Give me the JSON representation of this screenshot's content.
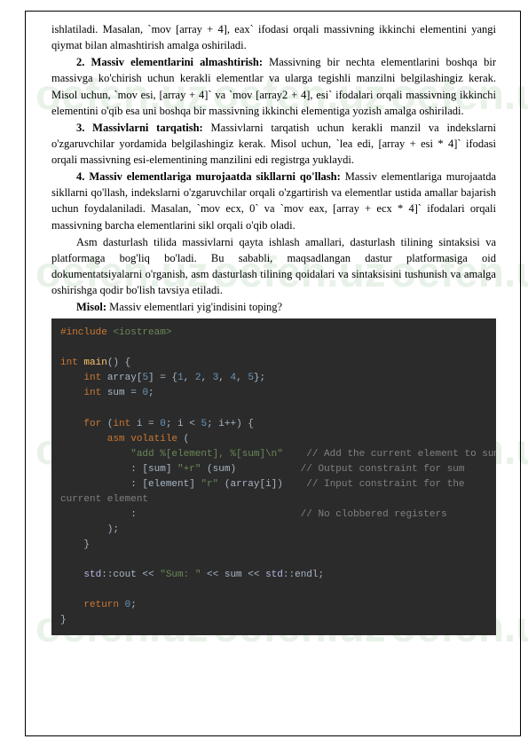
{
  "watermark": "oefen.uz",
  "paragraphs": {
    "p1": "ishlatiladi. Masalan, `mov [array + 4], eax` ifodasi orqali massivning ikkinchi elementini yangi qiymat bilan almashtirish amalga oshiriladi.",
    "p2_title": "2. Massiv elementlarini almashtirish:",
    "p2_body": " Massivning bir nechta elementlarini boshqa bir massivga ko'chirish uchun kerakli elementlar va ularga tegishli manzilni belgilashingiz kerak. Misol uchun, `mov esi, [array + 4]` va `mov [array2 + 4], esi` ifodalari orqali massivning ikkinchi elementini o'qib esa uni boshqa bir massivning ikkinchi elementiga yozish amalga oshiriladi.",
    "p3_title": "3. Massivlarni tarqatish:",
    "p3_body": " Massivlarni tarqatish uchun kerakli manzil va indekslarni o'zgaruvchilar yordamida belgilashingiz kerak. Misol uchun, `lea edi, [array + esi * 4]` ifodasi orqali massivning esi-elementining manzilini edi registrga yuklaydi.",
    "p4_title": "4. Massiv elementlariga murojaatda sikllarni qo'llash:",
    "p4_body": " Massiv elementlariga murojaatda sikllarni qo'llash, indekslarni o'zgaruvchilar orqali o'zgartirish va elementlar ustida amallar bajarish uchun foydalaniladi. Masalan, `mov ecx, 0` va `mov eax, [array + ecx * 4]` ifodalari orqali massivning barcha elementlarini sikl orqali o'qib oladi.",
    "p5": "Asm dasturlash tilida massivlarni qayta ishlash amallari, dasturlash tilining sintaksisi va platformaga bog'liq bo'ladi. Bu sababli, maqsadlangan dastur platformasiga oid dokumentatsiyalarni o'rganish, asm dasturlash tilining qoidalari va sintaksisini tushunish va amalga oshirishga qodir bo'lish tavsiya etiladi.",
    "p6_title": "Misol:",
    "p6_body": " Massiv elementlari yig'indisini toping?"
  },
  "code": {
    "l1_a": "#include",
    "l1_b": " <iostream>",
    "l3_a": "int",
    "l3_b": " main",
    "l3_c": "() {",
    "l4_a": "    int",
    "l4_b": " array",
    "l4_c": "[",
    "l4_d": "5",
    "l4_e": "] = {",
    "l4_f": "1",
    "l4_g": ", ",
    "l4_h": "2",
    "l4_i": "3",
    "l4_j": "4",
    "l4_k": "5",
    "l4_l": "};",
    "l5_a": "    int",
    "l5_b": " sum = ",
    "l5_c": "0",
    "l5_d": ";",
    "l7_a": "    for",
    "l7_b": " (",
    "l7_c": "int",
    "l7_d": " i = ",
    "l7_e": "0",
    "l7_f": "; i < ",
    "l7_g": "5",
    "l7_h": "; i++) {",
    "l8_a": "        asm volatile",
    "l8_b": " (",
    "l9_a": "            \"add %[element], %[sum]\\n\"",
    "l9_b": "    // Add the current element to sum",
    "l10_a": "            : [",
    "l10_b": "sum",
    "l10_c": "] ",
    "l10_d": "\"+r\"",
    "l10_e": " (sum)",
    "l10_f": "           // Output constraint for sum",
    "l11_a": "            : [",
    "l11_b": "element",
    "l11_c": "] ",
    "l11_d": "\"r\"",
    "l11_e": " (array[i])",
    "l11_f": "    // Input constraint for the",
    "l12": "current element",
    "l13_a": "            :",
    "l13_b": "                            // No clobbered registers",
    "l14": "        );",
    "l15": "    }",
    "l17_a": "    std",
    "l17_b": "::cout << ",
    "l17_c": "\"Sum: \"",
    "l17_d": " << sum << ",
    "l17_e": "std",
    "l17_f": "::endl;",
    "l19_a": "    return ",
    "l19_b": "0",
    "l19_c": ";",
    "l20": "}"
  }
}
